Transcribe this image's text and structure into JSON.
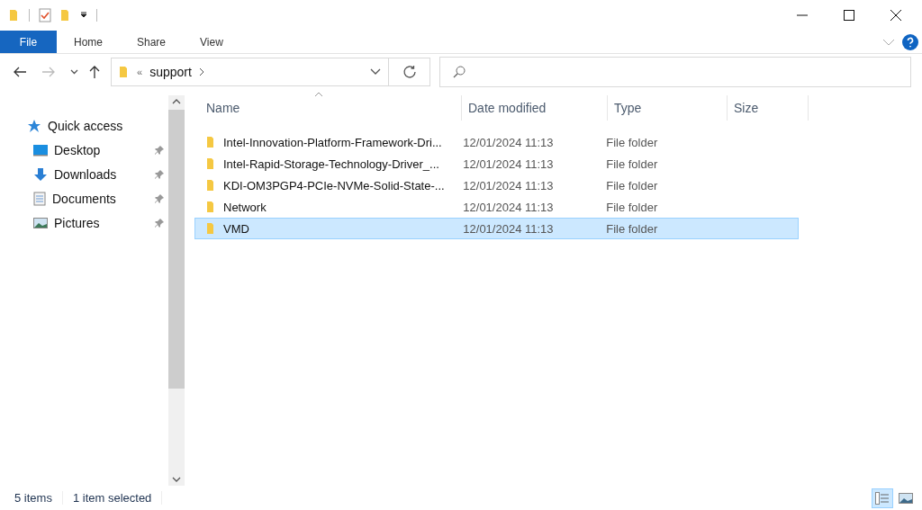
{
  "ribbon": {
    "tabs": [
      {
        "label": "File",
        "kind": "file"
      },
      {
        "label": "Home",
        "kind": "tab"
      },
      {
        "label": "Share",
        "kind": "tab"
      },
      {
        "label": "View",
        "kind": "tab"
      }
    ]
  },
  "address": {
    "overflow": "«",
    "crumbs": [
      "support"
    ]
  },
  "sidebar": {
    "items": [
      {
        "label": "Quick access",
        "kind": "star",
        "pinned": false
      },
      {
        "label": "Desktop",
        "kind": "desktop",
        "pinned": true
      },
      {
        "label": "Downloads",
        "kind": "download",
        "pinned": true
      },
      {
        "label": "Documents",
        "kind": "document",
        "pinned": true
      },
      {
        "label": "Pictures",
        "kind": "pictures",
        "pinned": true
      }
    ]
  },
  "table": {
    "columns": [
      "Name",
      "Date modified",
      "Type",
      "Size"
    ],
    "rows": [
      {
        "name": "Intel-Innovation-Platform-Framework-Dri...",
        "date": "12/01/2024 11:13",
        "type": "File folder",
        "selected": false
      },
      {
        "name": "Intel-Rapid-Storage-Technology-Driver_...",
        "date": "12/01/2024 11:13",
        "type": "File folder",
        "selected": false
      },
      {
        "name": "KDI-OM3PGP4-PCIe-NVMe-Solid-State-...",
        "date": "12/01/2024 11:13",
        "type": "File folder",
        "selected": false
      },
      {
        "name": "Network",
        "date": "12/01/2024 11:13",
        "type": "File folder",
        "selected": false
      },
      {
        "name": "VMD",
        "date": "12/01/2024 11:13",
        "type": "File folder",
        "selected": true
      }
    ]
  },
  "status_bar": {
    "items": "5 items",
    "selection": "1 item selected"
  },
  "views": [
    {
      "kind": "details",
      "selected": true
    },
    {
      "kind": "thumbnails",
      "selected": false
    }
  ]
}
